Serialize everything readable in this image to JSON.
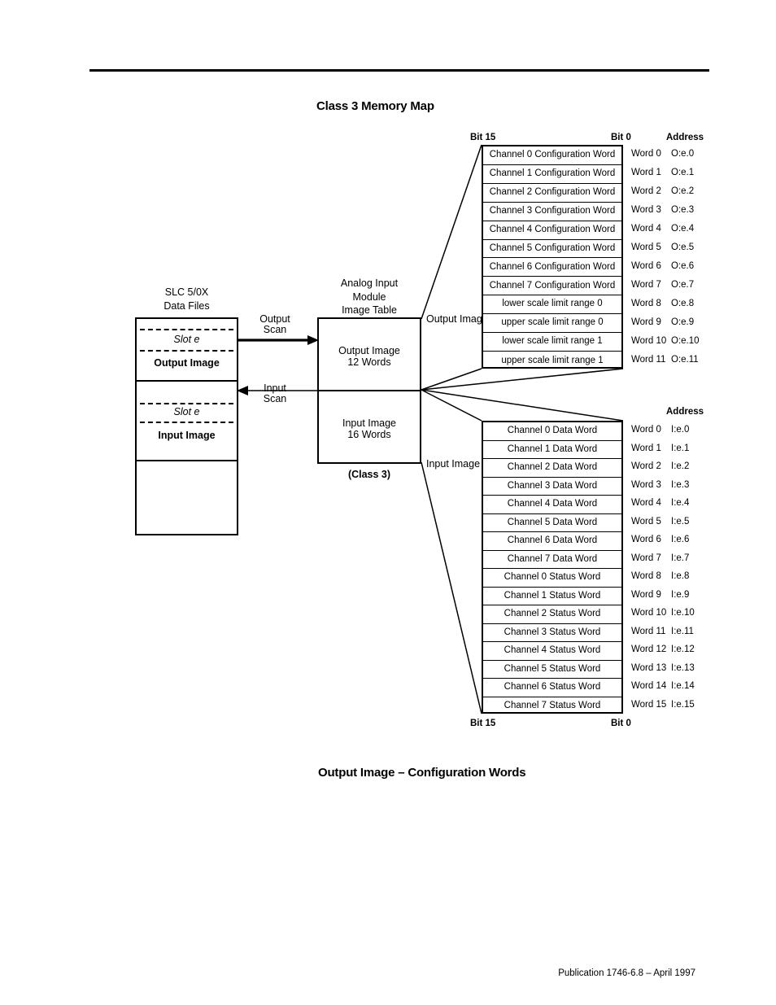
{
  "document": {
    "title": "Class 3 Memory Map",
    "subtitle": "Output Image – Configuration Words",
    "footer": "Publication 1746-6.8 – April 1997"
  },
  "left_block": {
    "heading_line1": "SLC 5/0X",
    "heading_line2": "Data Files",
    "slot_label_1": "Slot e",
    "section_label_1": "Output Image",
    "slot_label_2": "Slot e",
    "section_label_2": "Input Image"
  },
  "arrows": {
    "output_scan_line1": "Output",
    "output_scan_line2": "Scan",
    "input_scan_line1": "Input",
    "input_scan_line2": "Scan"
  },
  "module_block": {
    "heading_line1": "Analog Input",
    "heading_line2": "Module",
    "heading_line3": "Image Table",
    "output_image_line1": "Output Image",
    "output_image_line2": "12 Words",
    "input_image_line1": "Input Image",
    "input_image_line2": "16 Words",
    "class_label": "(Class 3)",
    "callout_output": "Output Image",
    "callout_input": "Input Image"
  },
  "output_table": {
    "bit_high_label": "Bit 15",
    "bit_low_label": "Bit 0",
    "address_header": "Address",
    "rows": [
      {
        "name": "Channel 0 Configuration Word",
        "word": "Word 0",
        "address": "O:e.0"
      },
      {
        "name": "Channel 1 Configuration Word",
        "word": "Word 1",
        "address": "O:e.1"
      },
      {
        "name": "Channel 2 Configuration Word",
        "word": "Word 2",
        "address": "O:e.2"
      },
      {
        "name": "Channel 3 Configuration Word",
        "word": "Word 3",
        "address": "O:e.3"
      },
      {
        "name": "Channel 4 Configuration Word",
        "word": "Word 4",
        "address": "O:e.4"
      },
      {
        "name": "Channel 5 Configuration Word",
        "word": "Word 5",
        "address": "O:e.5"
      },
      {
        "name": "Channel 6 Configuration Word",
        "word": "Word 6",
        "address": "O:e.6"
      },
      {
        "name": "Channel 7 Configuration Word",
        "word": "Word 7",
        "address": "O:e.7"
      },
      {
        "name": "lower scale limit range 0",
        "word": "Word 8",
        "address": "O:e.8"
      },
      {
        "name": "upper scale limit range 0",
        "word": "Word 9",
        "address": "O:e.9"
      },
      {
        "name": "lower scale limit range 1",
        "word": "Word 10",
        "address": "O:e.10"
      },
      {
        "name": "upper scale limit range 1",
        "word": "Word 11",
        "address": "O:e.11"
      }
    ]
  },
  "input_table": {
    "bit_high_label": "Bit 15",
    "bit_low_label": "Bit 0",
    "address_header": "Address",
    "rows": [
      {
        "name": "Channel 0 Data Word",
        "word": "Word 0",
        "address": "I:e.0"
      },
      {
        "name": "Channel 1 Data Word",
        "word": "Word 1",
        "address": "I:e.1"
      },
      {
        "name": "Channel 2 Data Word",
        "word": "Word 2",
        "address": "I:e.2"
      },
      {
        "name": "Channel 3 Data Word",
        "word": "Word 3",
        "address": "I:e.3"
      },
      {
        "name": "Channel 4 Data Word",
        "word": "Word 4",
        "address": "I:e.4"
      },
      {
        "name": "Channel 5 Data Word",
        "word": "Word 5",
        "address": "I:e.5"
      },
      {
        "name": "Channel 6 Data Word",
        "word": "Word 6",
        "address": "I:e.6"
      },
      {
        "name": "Channel 7 Data Word",
        "word": "Word 7",
        "address": "I:e.7"
      },
      {
        "name": "Channel 0 Status Word",
        "word": "Word 8",
        "address": "I:e.8"
      },
      {
        "name": "Channel 1 Status Word",
        "word": "Word 9",
        "address": "I:e.9"
      },
      {
        "name": "Channel 2 Status Word",
        "word": "Word 10",
        "address": "I:e.10"
      },
      {
        "name": "Channel 3 Status Word",
        "word": "Word 11",
        "address": "I:e.11"
      },
      {
        "name": "Channel 4 Status Word",
        "word": "Word 12",
        "address": "I:e.12"
      },
      {
        "name": "Channel 5 Status Word",
        "word": "Word 13",
        "address": "I:e.13"
      },
      {
        "name": "Channel 6 Status Word",
        "word": "Word 14",
        "address": "I:e.14"
      },
      {
        "name": "Channel 7 Status Word",
        "word": "Word 15",
        "address": "I:e.15"
      }
    ]
  },
  "colors": {
    "ink": "#000000",
    "paper": "#ffffff"
  }
}
